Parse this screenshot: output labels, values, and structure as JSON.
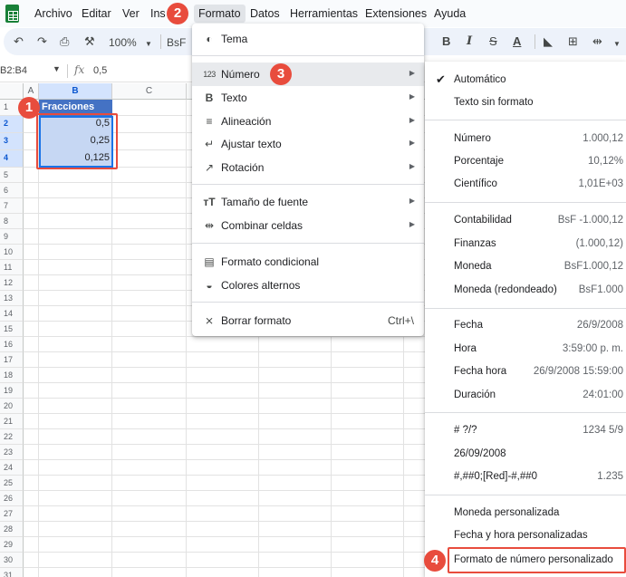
{
  "menubar": {
    "items": [
      "Archivo",
      "Editar",
      "Ver",
      "Ins",
      "Formato",
      "Datos",
      "Herramientas",
      "Extensiones",
      "Ayuda"
    ]
  },
  "toolbar": {
    "zoom": "100%",
    "font": "BsF"
  },
  "formula_bar": {
    "name_box": "B2:B4",
    "fx_label": "fx",
    "value": "0,5"
  },
  "grid": {
    "columns": [
      "A",
      "B",
      "C"
    ],
    "rows": [
      "1",
      "2",
      "3",
      "4",
      "5",
      "6",
      "7",
      "8",
      "9",
      "10",
      "11",
      "12",
      "13",
      "14",
      "15",
      "16",
      "17",
      "18",
      "19",
      "20",
      "21",
      "22",
      "23",
      "24",
      "25",
      "26",
      "27",
      "28",
      "29",
      "30",
      "31"
    ],
    "header_cell": "Fracciones",
    "values": [
      "0,5",
      "0,25",
      "0,125"
    ]
  },
  "callouts": [
    "1",
    "2",
    "3",
    "4"
  ],
  "format_menu": {
    "items": [
      {
        "icon": "palette-icon",
        "label": "Tema"
      },
      {
        "icon": "number-format-icon",
        "glyph": "123",
        "label": "Número",
        "submenu": true
      },
      {
        "icon": "bold-icon",
        "glyph": "B",
        "label": "Texto",
        "submenu": true
      },
      {
        "icon": "align-icon",
        "label": "Alineación",
        "submenu": true
      },
      {
        "icon": "wrap-text-icon",
        "label": "Ajustar texto",
        "submenu": true
      },
      {
        "icon": "rotation-icon",
        "label": "Rotación",
        "submenu": true
      },
      {
        "icon": "font-size-icon",
        "label": "Tamaño de fuente",
        "submenu": true
      },
      {
        "icon": "merge-cells-icon",
        "label": "Combinar celdas",
        "submenu": true
      },
      {
        "icon": "conditional-format-icon",
        "label": "Formato condicional"
      },
      {
        "icon": "alternating-colors-icon",
        "label": "Colores alternos"
      },
      {
        "icon": "clear-format-icon",
        "label": "Borrar formato",
        "shortcut": "Ctrl+\\"
      }
    ]
  },
  "number_submenu": {
    "items": [
      {
        "label": "Automático",
        "example": "",
        "checked": true
      },
      {
        "label": "Texto sin formato",
        "example": ""
      },
      {
        "label": "Número",
        "example": "1.000,12"
      },
      {
        "label": "Porcentaje",
        "example": "10,12%"
      },
      {
        "label": "Científico",
        "example": "1,01E+03"
      },
      {
        "label": "Contabilidad",
        "example": "BsF -1.000,12"
      },
      {
        "label": "Finanzas",
        "example": "(1.000,12)"
      },
      {
        "label": "Moneda",
        "example": "BsF1.000,12"
      },
      {
        "label": "Moneda (redondeado)",
        "example": "BsF1.000"
      },
      {
        "label": "Fecha",
        "example": "26/9/2008"
      },
      {
        "label": "Hora",
        "example": "3:59:00 p. m."
      },
      {
        "label": "Fecha hora",
        "example": "26/9/2008 15:59:00"
      },
      {
        "label": "Duración",
        "example": "24:01:00"
      },
      {
        "label": "# ?/?",
        "example": "1234 5/9"
      },
      {
        "label": "26/09/2008",
        "example": ""
      },
      {
        "label": "#,##0;[Red]-#,##0",
        "example": "1.235"
      },
      {
        "label": "Moneda personalizada",
        "example": ""
      },
      {
        "label": "Fecha y hora personalizadas",
        "example": ""
      },
      {
        "label": "Formato de número personalizado",
        "example": ""
      }
    ]
  },
  "colors": {
    "header_fill": "#4472c4",
    "value_fill": "#c6d7f3",
    "callout": "#e84c3d",
    "selection": "#1a73e8"
  }
}
